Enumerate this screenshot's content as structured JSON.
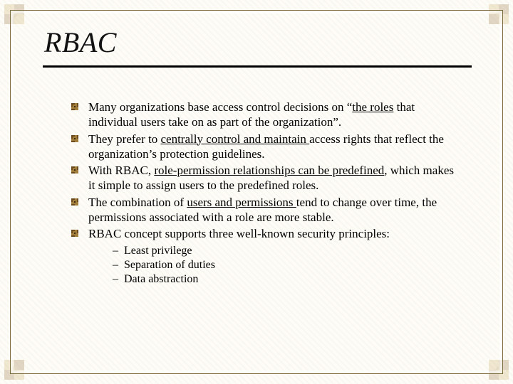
{
  "title": "RBAC",
  "bullets": [
    {
      "pre": "Many organizations base access control decisions on “",
      "u": "the roles",
      "post": " that individual users take on as part of the organization”."
    },
    {
      "pre": "They prefer to ",
      "u": "centrally control and maintain ",
      "post": "access rights that reflect the organization’s protection guidelines."
    },
    {
      "pre": "With RBAC, ",
      "u": "role-permission relationships can be predefined",
      "post": ", which makes it simple to assign users to the predefined roles."
    },
    {
      "pre": "The combination of ",
      "u": "users and permissions ",
      "post": "tend to change over time, the permissions associated with a role are more stable."
    },
    {
      "pre": "RBAC concept supports three well-known security principles:",
      "u": "",
      "post": ""
    }
  ],
  "sub": [
    "Least privilege",
    "Separation of duties",
    "Data abstraction"
  ]
}
